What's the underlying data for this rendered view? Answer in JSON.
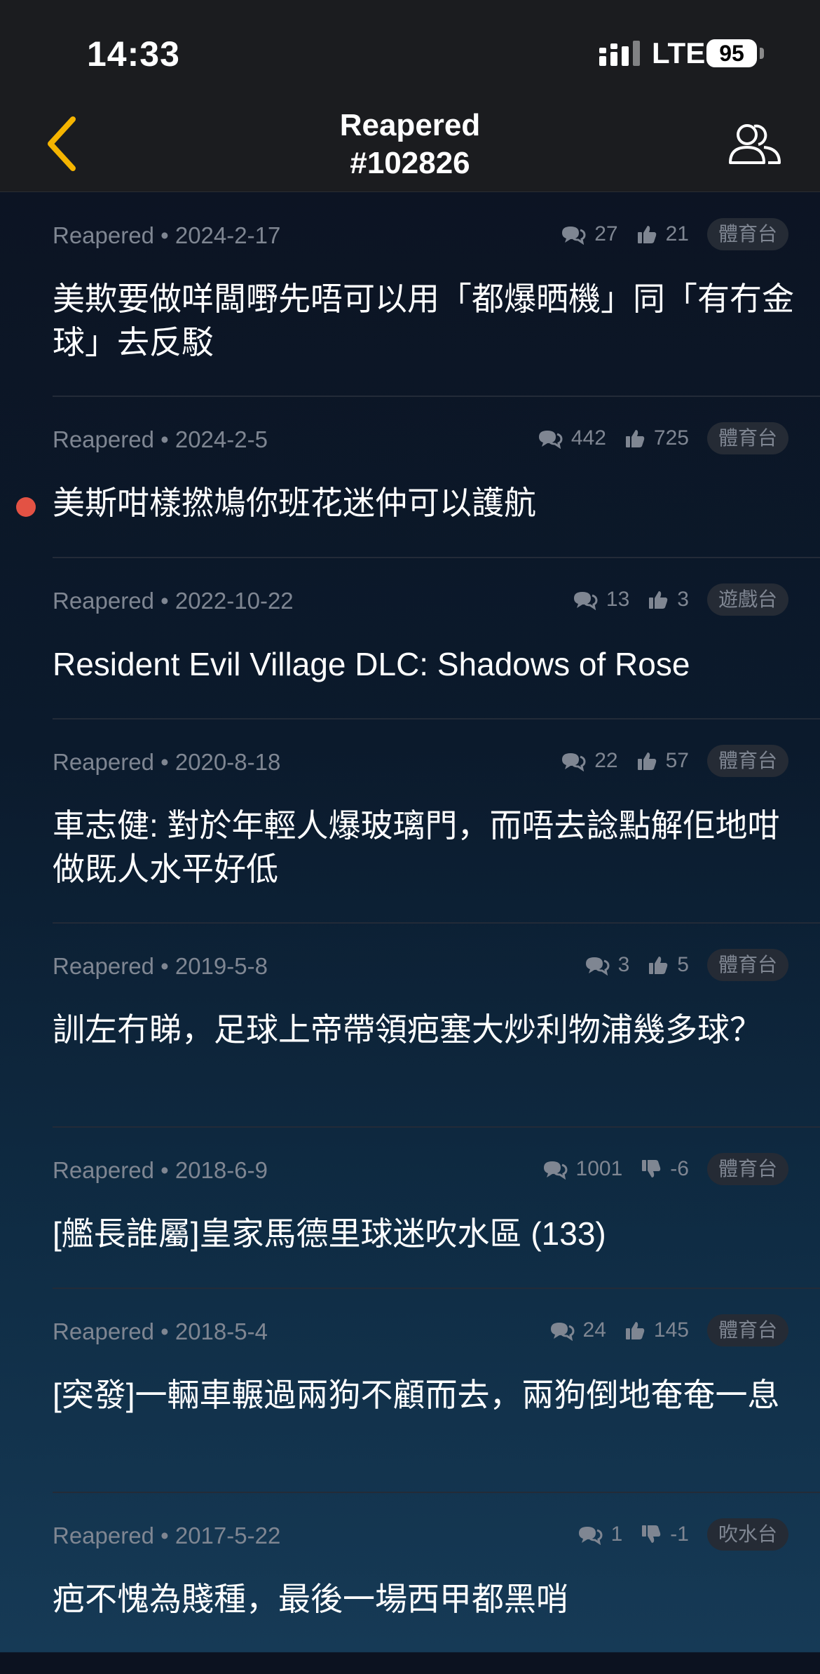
{
  "status_bar": {
    "time": "14:33",
    "network": "LTE",
    "battery": "95"
  },
  "nav": {
    "title_line1": "Reapered",
    "title_line2": "#102826"
  },
  "icons": {
    "back": "chevron-left-icon",
    "users": "users-icon",
    "comment": "comment-icon",
    "like": "thumbs-up-icon",
    "dislike": "thumbs-down-icon"
  },
  "colors": {
    "accent": "#f5b400",
    "unread": "#e35244"
  },
  "posts": [
    {
      "author": "Reapered",
      "date": "2024-2-17",
      "comments": "27",
      "votes": "21",
      "vote_type": "up",
      "board": "體育台",
      "unread": false,
      "title": "美欺要做咩闆嘢先唔可以用「都爆晒機」同「有冇金球」去反駁"
    },
    {
      "author": "Reapered",
      "date": "2024-2-5",
      "comments": "442",
      "votes": "725",
      "vote_type": "up",
      "board": "體育台",
      "unread": true,
      "title": "美斯咁樣撚鳩你班花迷仲可以護航"
    },
    {
      "author": "Reapered",
      "date": "2022-10-22",
      "comments": "13",
      "votes": "3",
      "vote_type": "up",
      "board": "遊戲台",
      "unread": false,
      "title": "Resident Evil Village DLC: Shadows of Rose"
    },
    {
      "author": "Reapered",
      "date": "2020-8-18",
      "comments": "22",
      "votes": "57",
      "vote_type": "up",
      "board": "體育台",
      "unread": false,
      "title": "車志健: 對於年輕人爆玻璃門，而唔去諗點解佢地咁做既人水平好低"
    },
    {
      "author": "Reapered",
      "date": "2019-5-8",
      "comments": "3",
      "votes": "5",
      "vote_type": "up",
      "board": "體育台",
      "unread": false,
      "title": "訓左冇睇，足球上帝帶領疤塞大炒利物浦幾多球？"
    },
    {
      "author": "Reapered",
      "date": "2018-6-9",
      "comments": "1001",
      "votes": "-6",
      "vote_type": "down",
      "board": "體育台",
      "unread": false,
      "title": "[艦長誰屬]皇家馬德里球迷吹水區 (133)"
    },
    {
      "author": "Reapered",
      "date": "2018-5-4",
      "comments": "24",
      "votes": "145",
      "vote_type": "up",
      "board": "體育台",
      "unread": false,
      "title": "[突發]一輛車輾過兩狗不顧而去，兩狗倒地奄奄一息"
    },
    {
      "author": "Reapered",
      "date": "2017-5-22",
      "comments": "1",
      "votes": "-1",
      "vote_type": "down",
      "board": "吹水台",
      "unread": false,
      "title": "疤不愧為賤種，最後一場西甲都黑哨"
    }
  ]
}
